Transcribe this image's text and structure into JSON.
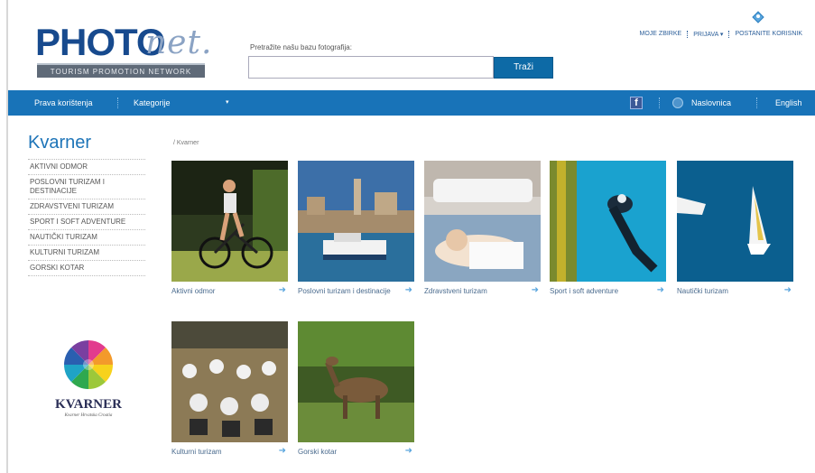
{
  "header": {
    "logo_main": "PHOTO",
    "logo_net": "net.",
    "logo_tagline": "TOURISM PROMOTION NETWORK",
    "search_label": "Pretražite našu bazu fotografija:",
    "search_value": "",
    "search_button": "Traži",
    "top_links": [
      "MOJE ZBIRKE",
      "PRIJAVA ▾",
      "POSTANITE KORISNIK"
    ]
  },
  "nav": {
    "usage_rights": "Prava korištenja",
    "categories": "Kategorije",
    "categories_arrow": "▾",
    "facebook": "f",
    "home": "Naslovnica",
    "language": "English"
  },
  "sidebar": {
    "title": "Kvarner",
    "items": [
      "AKTIVNI ODMOR",
      "POSLOVNI TURIZAM I DESTINACIJE",
      "ZDRAVSTVENI TURIZAM",
      "SPORT I SOFT ADVENTURE",
      "NAUTIČKI TURIZAM",
      "KULTURNI TURIZAM",
      "GORSKI KOTAR"
    ],
    "logo_name": "KVARNER",
    "logo_sub": "Kvarner Hrvatska Croatia"
  },
  "breadcrumb": "/ Kvarner",
  "tiles": [
    {
      "caption": "Aktivni odmor",
      "arrow": "➜"
    },
    {
      "caption": "Poslovni turizam i destinacije",
      "arrow": "➜"
    },
    {
      "caption": "Zdravstveni turizam",
      "arrow": "➜"
    },
    {
      "caption": "Sport i soft adventure",
      "arrow": "➜"
    },
    {
      "caption": "Nautički turizam",
      "arrow": "➜"
    },
    {
      "caption": "Kulturni turizam",
      "arrow": "➜"
    },
    {
      "caption": "Gorski kotar",
      "arrow": "➜"
    }
  ],
  "colors": {
    "brand_blue": "#1873b8",
    "logo_blue": "#174a8e",
    "link_blue": "#2c5f9a"
  }
}
